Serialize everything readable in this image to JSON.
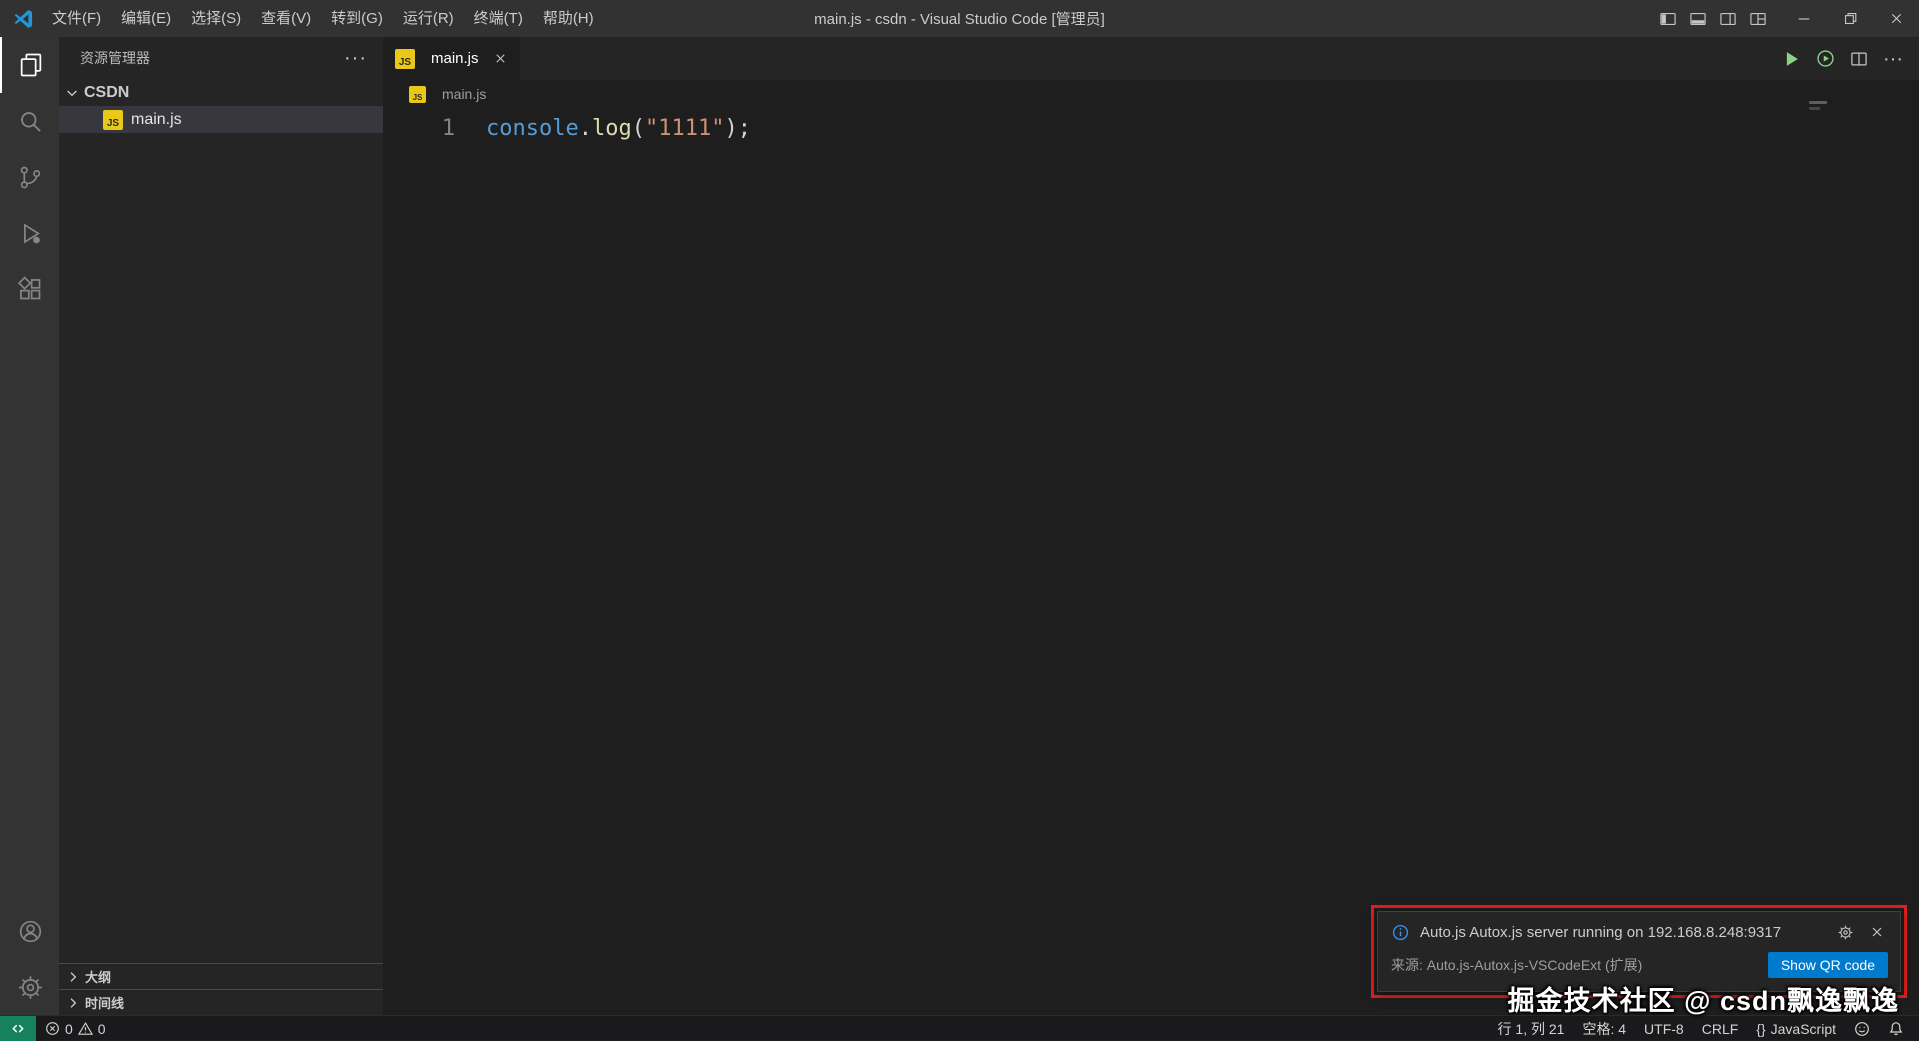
{
  "window": {
    "title": "main.js - csdn - Visual Studio Code [管理员]",
    "menus": [
      "文件(F)",
      "编辑(E)",
      "选择(S)",
      "查看(V)",
      "转到(G)",
      "运行(R)",
      "终端(T)",
      "帮助(H)"
    ]
  },
  "explorer": {
    "title": "资源管理器",
    "folder": "CSDN",
    "file": "main.js",
    "outline": "大纲",
    "timeline": "时间线"
  },
  "editor": {
    "tab": "main.js",
    "breadcrumb": "main.js",
    "line_number": "1",
    "code_plain": "console.log(\"1111\");",
    "tokens": [
      {
        "text": "console",
        "color": "#569cd6"
      },
      {
        "text": ".",
        "color": "#d4d4d4"
      },
      {
        "text": "log",
        "color": "#dcdcaa"
      },
      {
        "text": "(",
        "color": "#d4d4d4"
      },
      {
        "text": "\"1111\"",
        "color": "#ce9178"
      },
      {
        "text": ")",
        "color": "#d4d4d4"
      },
      {
        "text": ";",
        "color": "#d4d4d4"
      }
    ]
  },
  "notification": {
    "message": "Auto.js Autox.js server running on 192.168.8.248:9317",
    "source": "来源: Auto.js-Autox.js-VSCodeExt (扩展)",
    "button": "Show QR code"
  },
  "watermark": "掘金技术社区 @ csdn飘逸飘逸",
  "status": {
    "errors": "0",
    "warnings": "0",
    "cursor": "行 1, 列 21",
    "indent": "空格: 4",
    "encoding": "UTF-8",
    "eol": "CRLF",
    "lang_braces": "{}",
    "language": "JavaScript"
  },
  "colors": {
    "accent": "#007acc",
    "info_blue": "#3794ff",
    "run_green": "#89d185",
    "js_icon_yellow": "#e8c819",
    "annotation_red": "#e51e1e",
    "remote_green": "#16825d",
    "string_orange": "#ce9178"
  }
}
